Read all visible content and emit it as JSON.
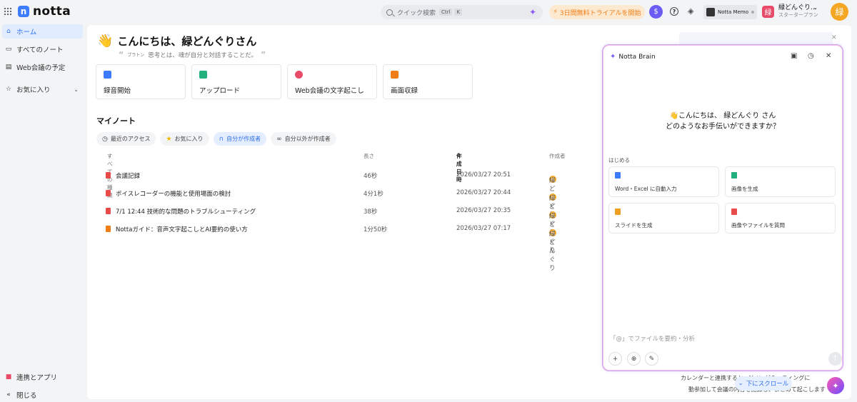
{
  "app": {
    "logo_letter": "n",
    "name": "notta"
  },
  "search": {
    "placeholder": "クイック検索",
    "kbd_ctrl": "Ctrl",
    "kbd_k": "K"
  },
  "header": {
    "trial_label": "3日間無料トライアルを開始",
    "coin_symbol": "$",
    "memo_label": "Notta Memo",
    "user_name": "緑どんぐり...",
    "user_plan": "スタータープラン",
    "user_avatar_char": "緑",
    "profile_avatar_char": "緑"
  },
  "sidebar": {
    "items": [
      {
        "label": "ホーム",
        "icon": "home-icon"
      },
      {
        "label": "すべてのノート",
        "icon": "folder-icon"
      },
      {
        "label": "Web会議の予定",
        "icon": "calendar-icon"
      },
      {
        "label": "お気に入り",
        "icon": "star-icon"
      }
    ],
    "bottom": {
      "integrations": "連携とアプリ",
      "collapse": "閉じる"
    }
  },
  "main": {
    "greeting": "こんにちは、緑どんぐりさん",
    "quote_author": "プラトン",
    "quote_text": "思考とは、魂が自分と対話することだ。",
    "actions": [
      {
        "label": "録音開始",
        "color": "#3d7bff"
      },
      {
        "label": "アップロード",
        "color": "#22b07d"
      },
      {
        "label": "Web会議の文字起こし",
        "color": "#e94a68"
      },
      {
        "label": "画面収録",
        "color": "#f07d16"
      }
    ],
    "section_title": "マイノート",
    "filters": [
      {
        "label": "最近のアクセス"
      },
      {
        "label": "お気に入り"
      },
      {
        "label": "自分が作成者"
      },
      {
        "label": "自分以外が作成者"
      }
    ],
    "table": {
      "headers": {
        "type": "すべての種類",
        "length": "長さ",
        "created": "作成日時",
        "author": "作成者"
      },
      "rows": [
        {
          "title": "会議記録",
          "length": "46秒",
          "created": "2026/03/27 20:51",
          "author": "緑どんぐり",
          "icon_color": "#e94a4a"
        },
        {
          "title": "ボイスレコーダーの機能と使用場面の検討",
          "length": "4分1秒",
          "created": "2026/03/27 20:44",
          "author": "緑どんぐり",
          "icon_color": "#e94a4a"
        },
        {
          "title": "7/1 12:44 技術的な問題のトラブルシューティング",
          "length": "38秒",
          "created": "2026/03/27 20:35",
          "author": "緑どんぐり",
          "icon_color": "#e94a4a"
        },
        {
          "title": "Nottaガイド：音声文字起こしとAI要約の使い方",
          "length": "1分50秒",
          "created": "2026/03/27 07:17",
          "author": "緑どんぐり",
          "icon_color": "#f07d16"
        }
      ]
    },
    "background_text_1": "カレンダーと連携すると、Nottaがミーティングに",
    "background_text_2": "動参加して会議の内容を記録し、まとめて起こします"
  },
  "brain": {
    "title": "Notta Brain",
    "hello_line1": "👋こんにちは、 緑どんぐり さん",
    "hello_line2": "どのようなお手伝いができますか？",
    "start_label": "はじめる",
    "actions": [
      {
        "label": "Word・Excel に自動入力",
        "color": "#3d7bff"
      },
      {
        "label": "画像を生成",
        "color": "#22b07d"
      },
      {
        "label": "スライドを生成",
        "color": "#f0a020"
      },
      {
        "label": "画像やファイルを質問",
        "color": "#e94a4a"
      }
    ],
    "input_placeholder": "「@」でファイルを要約・分析"
  },
  "scroll_button": "下にスクロール"
}
